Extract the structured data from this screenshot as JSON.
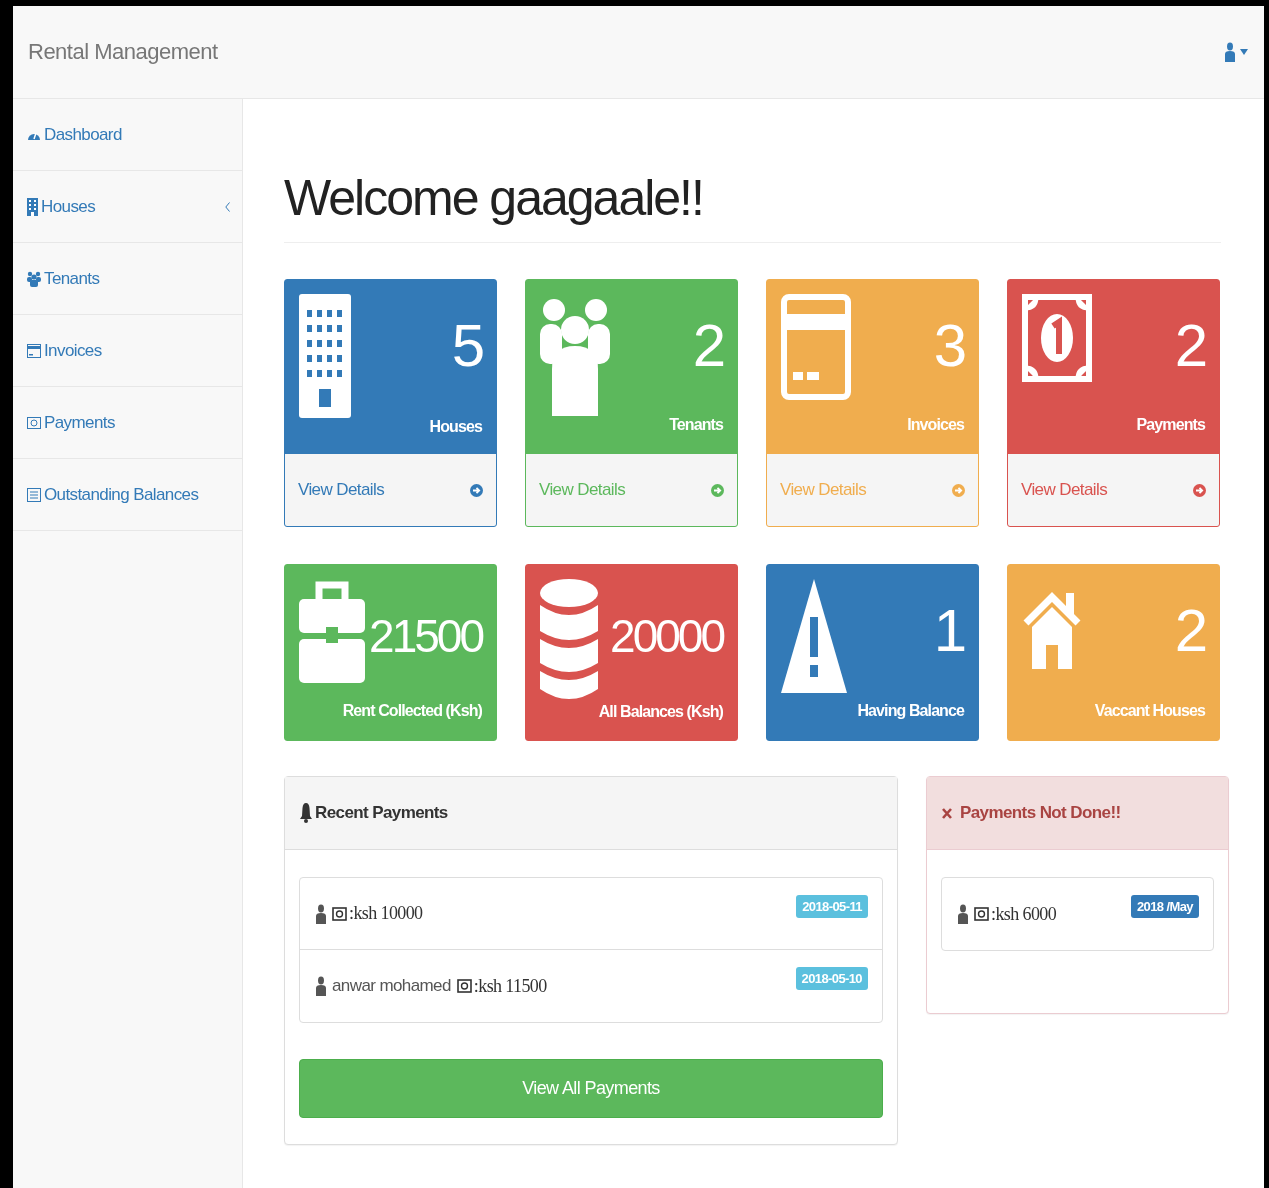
{
  "brand": "Rental Management",
  "sidebar": {
    "items": [
      {
        "label": "Dashboard",
        "has_submenu": false
      },
      {
        "label": "Houses",
        "has_submenu": true
      },
      {
        "label": "Tenants",
        "has_submenu": false
      },
      {
        "label": "Invoices",
        "has_submenu": false
      },
      {
        "label": "Payments",
        "has_submenu": false
      },
      {
        "label": "Outstanding Balances",
        "has_submenu": false
      }
    ]
  },
  "page_title": "Welcome gaagaale!!",
  "stat_cards": [
    {
      "count": "5",
      "label": "Houses",
      "color": "#337ab7",
      "link": "View Details"
    },
    {
      "count": "2",
      "label": "Tenants",
      "color": "#5cb85c",
      "link": "View Details"
    },
    {
      "count": "3",
      "label": "Invoices",
      "color": "#f0ad4e",
      "link": "View Details"
    },
    {
      "count": "2",
      "label": "Payments",
      "color": "#d9534f",
      "link": "View Details"
    },
    {
      "count": "21500",
      "label": "Rent Collected (Ksh)",
      "color": "#5cb85c"
    },
    {
      "count": "20000",
      "label": "All Balances (Ksh)",
      "color": "#d9534f"
    },
    {
      "count": "1",
      "label": "Having Balance",
      "color": "#337ab7"
    },
    {
      "count": "2",
      "label": "Vaccant Houses",
      "color": "#f0ad4e"
    }
  ],
  "recent_payments": {
    "title": "Recent Payments",
    "items": [
      {
        "amount": ":ksh 10000",
        "date": "2018-05-11"
      },
      {
        "tenant": "anwar mohamed",
        "amount": ":ksh 11500",
        "date": "2018-05-10"
      }
    ],
    "button": "View All Payments"
  },
  "payments_not_done": {
    "title": "Payments Not Done!!",
    "items": [
      {
        "amount": ":ksh 6000",
        "period": "2018 /May"
      }
    ]
  }
}
